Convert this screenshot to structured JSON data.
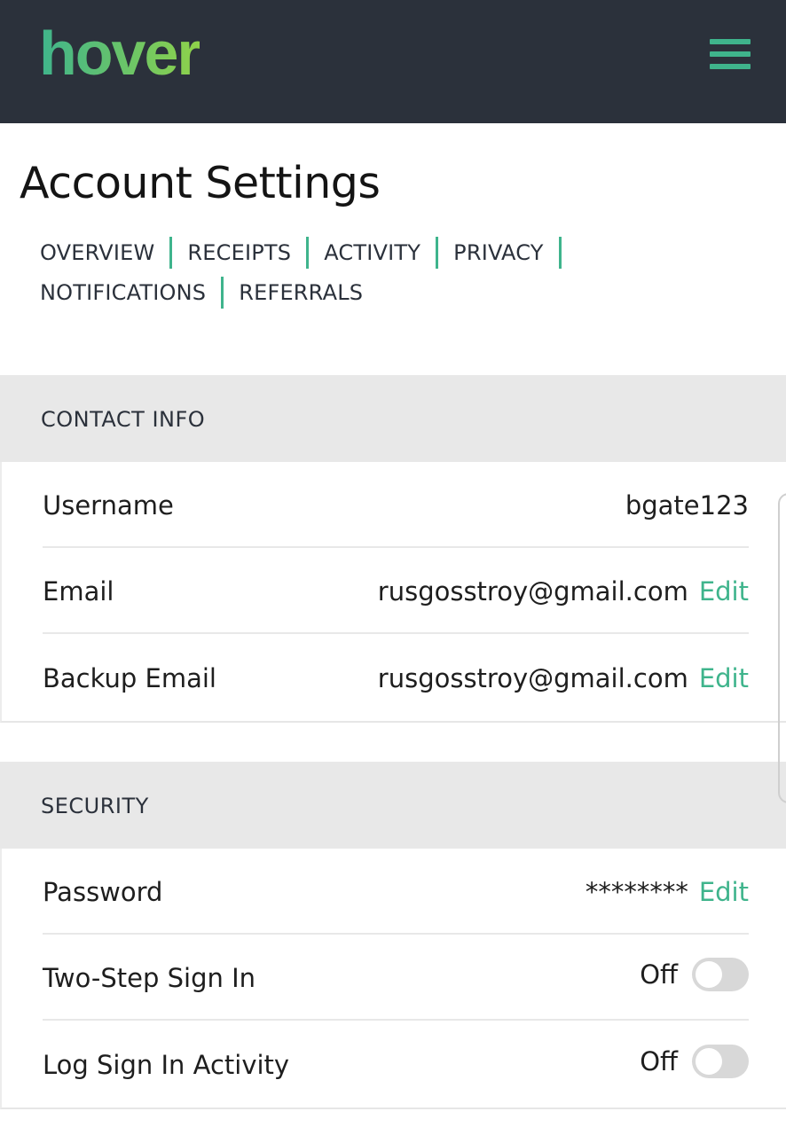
{
  "header": {
    "logo_text": "hover",
    "menu_icon": "hamburger-menu-icon",
    "brand_color": "#3fb48c",
    "bar_color": "#2b313b"
  },
  "page_title": "Account Settings",
  "nav": {
    "row1": [
      "OVERVIEW",
      "RECEIPTS",
      "ACTIVITY",
      "PRIVACY"
    ],
    "row2": [
      "NOTIFICATIONS",
      "REFERRALS"
    ]
  },
  "contact": {
    "header": "CONTACT INFO",
    "username_label": "Username",
    "username_value": "bgate123",
    "email_label": "Email",
    "email_value": "rusgosstroy@gmail.com",
    "email_edit": "Edit",
    "backup_label": "Backup Email",
    "backup_value": "rusgosstroy@gmail.com",
    "backup_edit": "Edit"
  },
  "security": {
    "header": "SECURITY",
    "password_label": "Password",
    "password_value": "********",
    "password_edit": "Edit",
    "twostep_label": "Two-Step Sign In",
    "twostep_state": "Off",
    "logsignin_label": "Log Sign In Activity",
    "logsignin_state": "Off"
  }
}
